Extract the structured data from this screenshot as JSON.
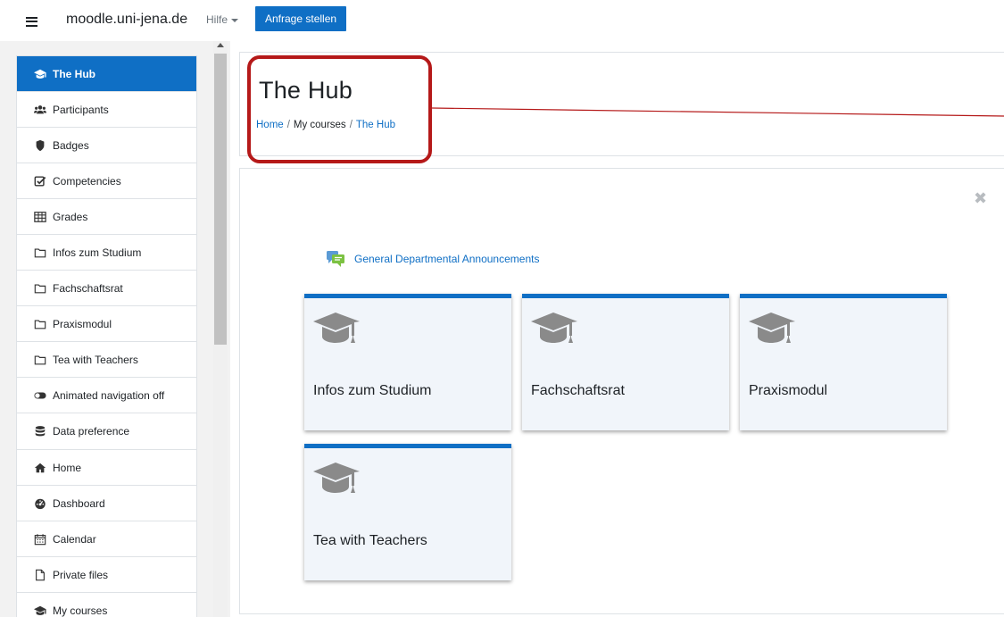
{
  "navbar": {
    "brand": "moodle.uni-jena.de",
    "help_label": "Hilfe",
    "request_button": "Anfrage stellen"
  },
  "sidebar": {
    "course_nav": [
      {
        "label": "The Hub",
        "icon": "graduation-cap-icon",
        "active": true
      },
      {
        "label": "Participants",
        "icon": "users-icon"
      },
      {
        "label": "Badges",
        "icon": "shield-icon"
      },
      {
        "label": "Competencies",
        "icon": "check-square-icon"
      },
      {
        "label": "Grades",
        "icon": "table-icon"
      },
      {
        "label": "Infos zum Studium",
        "icon": "folder-icon"
      },
      {
        "label": "Fachschaftsrat",
        "icon": "folder-icon"
      },
      {
        "label": "Praxismodul",
        "icon": "folder-icon"
      },
      {
        "label": "Tea with Teachers",
        "icon": "folder-icon"
      },
      {
        "label": "Animated navigation off",
        "icon": "toggle-icon"
      },
      {
        "label": "Data preference",
        "icon": "database-icon"
      }
    ],
    "site_nav": [
      {
        "label": "Home",
        "icon": "home-icon"
      },
      {
        "label": "Dashboard",
        "icon": "dashboard-icon"
      },
      {
        "label": "Calendar",
        "icon": "calendar-icon"
      },
      {
        "label": "Private files",
        "icon": "file-icon"
      },
      {
        "label": "My courses",
        "icon": "graduation-cap-icon"
      }
    ]
  },
  "header": {
    "title": "The Hub",
    "breadcrumb": [
      {
        "label": "Home",
        "link": true
      },
      {
        "label": "My courses",
        "link": false
      },
      {
        "label": "The Hub",
        "link": true
      }
    ]
  },
  "content": {
    "forum_link": "General Departmental Announcements",
    "tiles": [
      {
        "name": "Infos zum Studium"
      },
      {
        "name": "Fachschaftsrat"
      },
      {
        "name": "Praxismodul"
      },
      {
        "name": "Tea with Teachers"
      }
    ]
  },
  "colors": {
    "primary": "#0f6fc5",
    "highlight": "#b51919",
    "tile_bg": "#f1f5fa"
  }
}
